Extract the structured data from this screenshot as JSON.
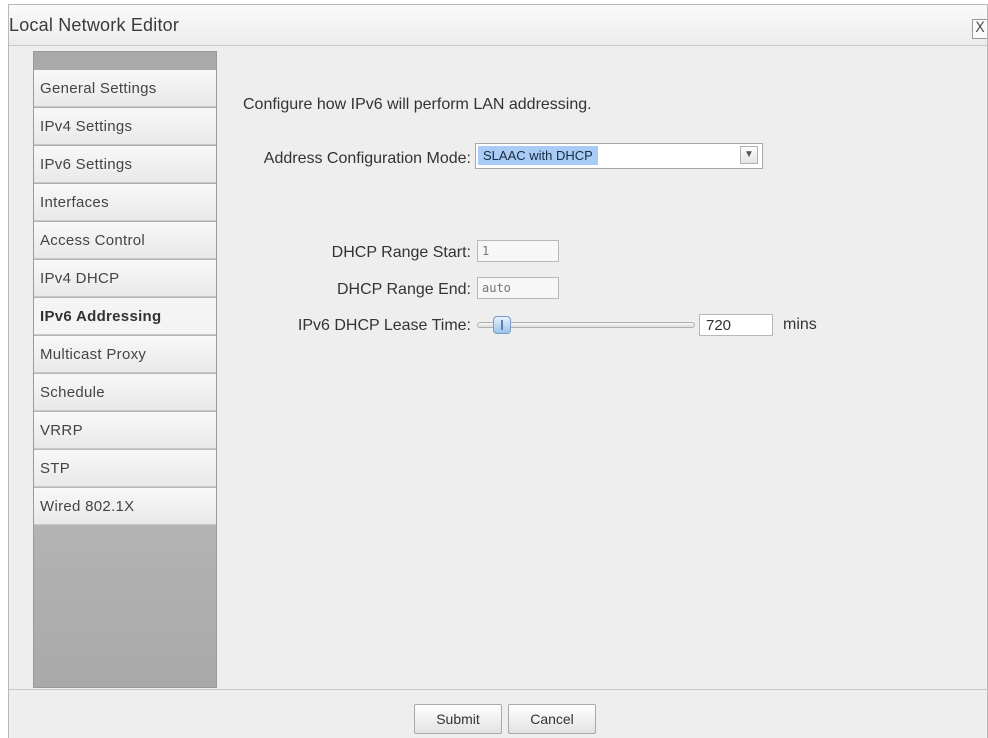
{
  "window": {
    "title": "Local Network Editor",
    "close_glyph": "X"
  },
  "sidebar": {
    "items": [
      {
        "label": "General Settings"
      },
      {
        "label": "IPv4 Settings"
      },
      {
        "label": "IPv6 Settings"
      },
      {
        "label": "Interfaces"
      },
      {
        "label": "Access Control"
      },
      {
        "label": "IPv4 DHCP"
      },
      {
        "label": "IPv6 Addressing",
        "active": true
      },
      {
        "label": "Multicast Proxy"
      },
      {
        "label": "Schedule"
      },
      {
        "label": "VRRP"
      },
      {
        "label": "STP"
      },
      {
        "label": "Wired 802.1X"
      }
    ]
  },
  "main": {
    "description": "Configure how IPv6 will perform LAN addressing.",
    "address_mode": {
      "label": "Address Configuration Mode:",
      "value": "SLAAC with DHCP"
    },
    "range_start": {
      "label": "DHCP Range Start:",
      "placeholder": "1"
    },
    "range_end": {
      "label": "DHCP Range End:",
      "placeholder": "auto"
    },
    "lease_time": {
      "label": "IPv6 DHCP Lease Time:",
      "value": "720",
      "unit": "mins",
      "slider_fraction": 0.05
    }
  },
  "footer": {
    "submit_label": "Submit",
    "cancel_label": "Cancel"
  },
  "colors": {
    "selection_highlight": "#a8ccf5",
    "slider_handle": "#9cc2ec",
    "sidebar_bg": "#b0b0b0"
  },
  "icons": {
    "close": "close-icon",
    "dropdown": "chevron-down-icon"
  }
}
